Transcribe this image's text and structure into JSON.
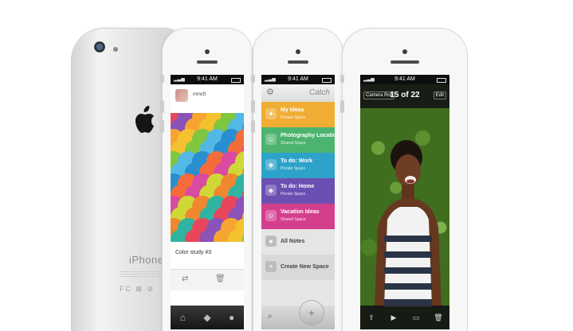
{
  "status_time": "9:41 AM",
  "back_phone": {
    "brand": "iPhone"
  },
  "instagram": {
    "username": "mmcft",
    "caption": "Color study #3",
    "scale_colors": [
      "#e8465a",
      "#f36c3a",
      "#f7a531",
      "#cfd836",
      "#7fc641",
      "#2fb4a2",
      "#2a8fd0",
      "#8b52b8",
      "#d94aa1",
      "#f3c22e",
      "#f0882f",
      "#54b8e4"
    ]
  },
  "catch": {
    "logo": "Catch",
    "items": [
      {
        "title": "My Ideas",
        "subtitle": "Private Space",
        "color": "#f0ad34",
        "icon": "bulb-icon"
      },
      {
        "title": "Photography Location",
        "subtitle": "Shared Space",
        "color": "#4cb46f",
        "icon": "people-icon"
      },
      {
        "title": "To do: Work",
        "subtitle": "Private Space",
        "color": "#2ea3c9",
        "icon": "cube-icon"
      },
      {
        "title": "To do: Home",
        "subtitle": "Private Space",
        "color": "#6b4fb3",
        "icon": "cube-icon"
      },
      {
        "title": "Vacation Ideas",
        "subtitle": "Shared Space",
        "color": "#d43f8d",
        "icon": "people-icon"
      },
      {
        "title": "All Notes",
        "subtitle": "",
        "color": "#e5e5e5",
        "icon": "notes-icon"
      },
      {
        "title": "Create New Space",
        "subtitle": "",
        "color": "#d9d9d9",
        "icon": "plus-icon"
      }
    ]
  },
  "photos": {
    "camera_roll": "Camera Roll",
    "counter": "15 of 22",
    "edit": "Edit"
  }
}
